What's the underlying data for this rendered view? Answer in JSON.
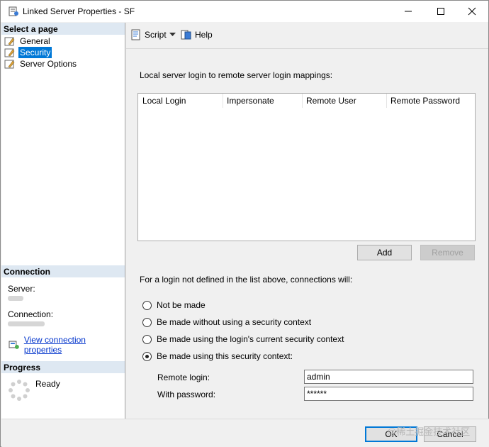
{
  "window": {
    "title": "Linked Server Properties - SF"
  },
  "left_pane": {
    "select_page_header": "Select a page",
    "pages": [
      {
        "label": "General",
        "selected": false
      },
      {
        "label": "Security",
        "selected": true
      },
      {
        "label": "Server Options",
        "selected": false
      }
    ],
    "connection_header": "Connection",
    "server_label": "Server:",
    "connection_label": "Connection:",
    "view_connection_link": "View connection properties",
    "progress_header": "Progress",
    "progress_status": "Ready"
  },
  "toolbar": {
    "script_label": "Script",
    "help_label": "Help"
  },
  "main": {
    "mappings_label": "Local server login to remote server login mappings:",
    "columns": [
      "Local Login",
      "Impersonate",
      "Remote User",
      "Remote Password"
    ],
    "add_button": "Add",
    "remove_button": "Remove",
    "undefined_login_label": "For a login not defined in the list above, connections will:",
    "radio_options": [
      {
        "label": "Not be made",
        "checked": false
      },
      {
        "label": "Be made without using a security context",
        "checked": false
      },
      {
        "label": "Be made using the login's current security context",
        "checked": false
      },
      {
        "label": "Be made using this security context:",
        "checked": true
      }
    ],
    "remote_login_label": "Remote login:",
    "remote_login_value": "admin",
    "password_label": "With password:",
    "password_value": "******"
  },
  "footer": {
    "ok_button": "OK",
    "cancel_button": "Cancel"
  },
  "watermark": "@稀土掘金技术社区",
  "colors": {
    "selection": "#0078d7",
    "header_band": "#dee8f2",
    "link": "#0033cc"
  }
}
